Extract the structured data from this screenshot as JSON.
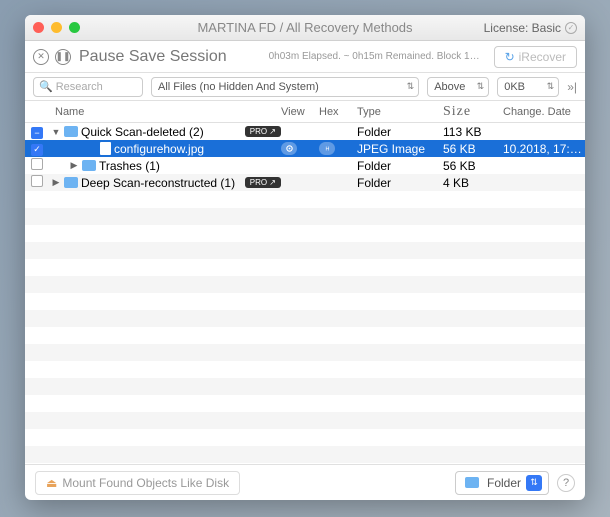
{
  "window": {
    "title": "MARTINA FD / All Recovery Methods",
    "license_label": "License: Basic"
  },
  "toolbar": {
    "session_label": "Pause Save Session",
    "status_text": "0h03m Elapsed. ~ 0h15m Remained. Block 1…",
    "recover_label": "iRecover"
  },
  "filters": {
    "search_placeholder": "Research",
    "file_filter": "All Files (no Hidden And System)",
    "position": "Above",
    "size_filter": "0KB"
  },
  "columns": {
    "name": "Name",
    "view": "View",
    "hex": "Hex",
    "type": "Type",
    "size": "Size",
    "date": "Change. Date"
  },
  "rows": [
    {
      "checked": "minus",
      "depth": 1,
      "disclosure": "▼",
      "icon": "folder",
      "label": "Quick Scan-deleted (2)",
      "badge": "PRO ↗",
      "type": "Folder",
      "size": "113 KB",
      "date": "",
      "selected": false
    },
    {
      "checked": "checked",
      "depth": 3,
      "disclosure": "",
      "icon": "file",
      "label": "configurehow.jpg",
      "view_pill": true,
      "hex_pill": true,
      "type": "JPEG Image",
      "size": "56 KB",
      "date": "10.2018, 17:…",
      "selected": true
    },
    {
      "checked": "",
      "depth": 2,
      "disclosure": "▶",
      "icon": "folder",
      "label": "Trashes (1)",
      "type": "Folder",
      "size": "56 KB",
      "date": "",
      "selected": false
    },
    {
      "checked": "",
      "depth": 1,
      "disclosure": "▶",
      "icon": "folder",
      "label": "Deep Scan-reconstructed (1)",
      "badge": "PRO ↗",
      "type": "Folder",
      "size": "4 KB",
      "date": "",
      "selected": false
    }
  ],
  "footer": {
    "mount_label": "Mount Found Objects Like Disk",
    "dest_label": "Folder"
  }
}
